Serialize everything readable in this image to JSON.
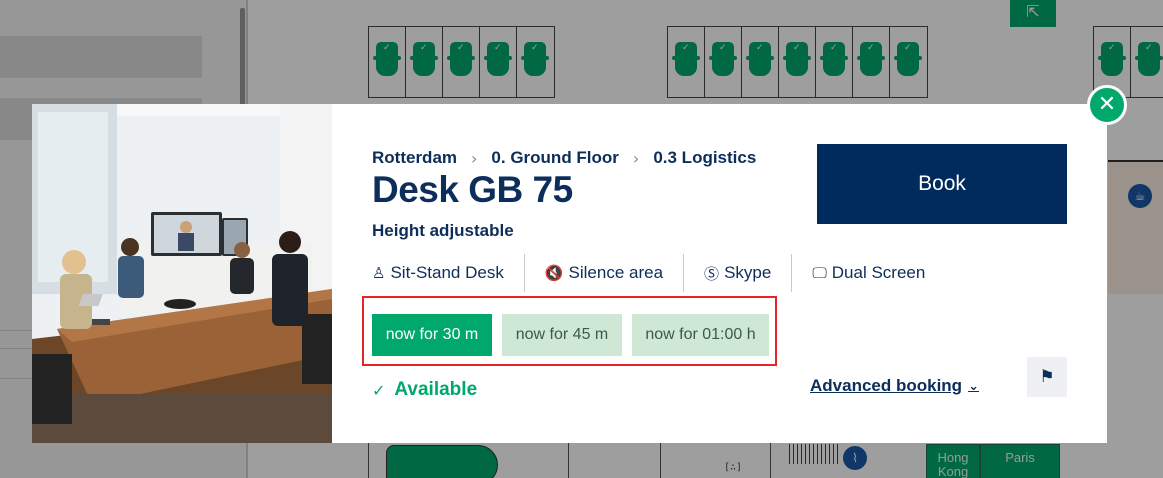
{
  "background": {
    "meeting_rooms": [
      {
        "name": "Hong Kong"
      },
      {
        "name": "Paris"
      }
    ],
    "icons": [
      "emergency-exit-icon",
      "coffee-icon",
      "stairs-icon",
      "desk-available-icon"
    ]
  },
  "modal": {
    "photo_alt": "meeting-room-photo",
    "breadcrumb": [
      "Rotterdam",
      "0. Ground Floor",
      "0.3 Logistics"
    ],
    "title": "Desk GB 75",
    "subtitle": "Height adjustable",
    "features": [
      {
        "label": "Sit-Stand Desk",
        "icon": "person-standing-icon"
      },
      {
        "label": "Silence area",
        "icon": "muted-speaker-icon"
      },
      {
        "label": "Skype",
        "icon": "skype-icon"
      },
      {
        "label": "Dual Screen",
        "icon": "monitor-icon"
      }
    ],
    "quick_book": [
      {
        "label": "now for 30 m",
        "selected": true
      },
      {
        "label": "now for 45 m",
        "selected": false
      },
      {
        "label": "now for 01:00 h",
        "selected": false
      }
    ],
    "status": "Available",
    "book_label": "Book",
    "advanced_booking_label": "Advanced booking",
    "colors": {
      "primary_navy": "#002b5c",
      "accent_green": "#00a86b",
      "pale_green": "#cfe8d6",
      "highlight_red": "#e8242a"
    }
  }
}
